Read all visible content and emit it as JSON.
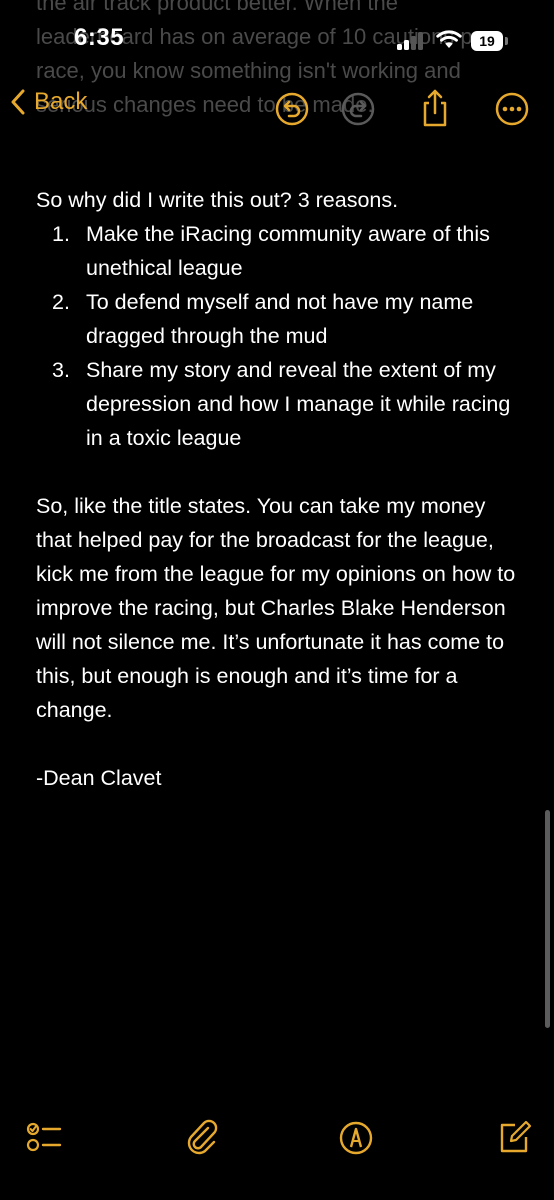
{
  "status_bar": {
    "time": "6:35",
    "battery_level": "19"
  },
  "nav": {
    "back_label": "Back"
  },
  "ghost_lines": [
    "the air track product better. When the",
    "leaderboard has on average of 10 cautions per",
    "race, you know something isn't working and",
    "serious changes need to be made."
  ],
  "note": {
    "intro": "So why did I write this out? 3 reasons.",
    "reasons": [
      {
        "number": "1.",
        "text": "Make the iRacing community aware of this unethical league"
      },
      {
        "number": "2.",
        "text": "To defend myself and not have my name dragged through the mud"
      },
      {
        "number": "3.",
        "text": "Share my story and reveal the extent of my depression and how I manage it while racing in a toxic league"
      }
    ],
    "closing": "So, like the title states. You can take my money that helped pay for the broadcast for the league, kick me from the league for my opinions on how to improve the racing, but Charles Blake Henderson will not silence me. It’s unfortunate it has come to this, but enough is enough and it’s time for a change.",
    "signature": "-Dean Clavet"
  },
  "icons": {
    "accent": "#e6a92e",
    "toolbar": [
      "checklist-icon",
      "attachment-icon",
      "markup-icon",
      "compose-icon"
    ],
    "nav": [
      "undo-icon",
      "redo-icon",
      "share-icon",
      "more-icon"
    ]
  }
}
